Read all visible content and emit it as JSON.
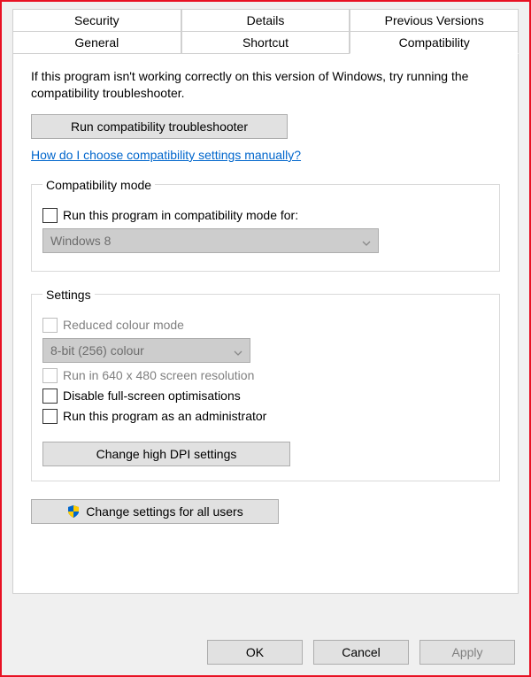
{
  "tabs": {
    "row1": [
      "Security",
      "Details",
      "Previous Versions"
    ],
    "row2": [
      "General",
      "Shortcut",
      "Compatibility"
    ],
    "active": "Compatibility"
  },
  "intro": "If this program isn't working correctly on this version of Windows, try running the compatibility troubleshooter.",
  "troubleshoot_btn": "Run compatibility troubleshooter",
  "help_link": "How do I choose compatibility settings manually?",
  "compat_group": {
    "legend": "Compatibility mode",
    "checkbox_label": "Run this program in compatibility mode for:",
    "combo_value": "Windows 8"
  },
  "settings_group": {
    "legend": "Settings",
    "reduced_colour": "Reduced colour mode",
    "colour_combo": "8-bit (256) colour",
    "run_640": "Run in 640 x 480 screen resolution",
    "disable_fullscreen": "Disable full-screen optimisations",
    "run_admin": "Run this program as an administrator",
    "dpi_btn": "Change high DPI settings"
  },
  "all_users_btn": "Change settings for all users",
  "footer": {
    "ok": "OK",
    "cancel": "Cancel",
    "apply": "Apply"
  }
}
